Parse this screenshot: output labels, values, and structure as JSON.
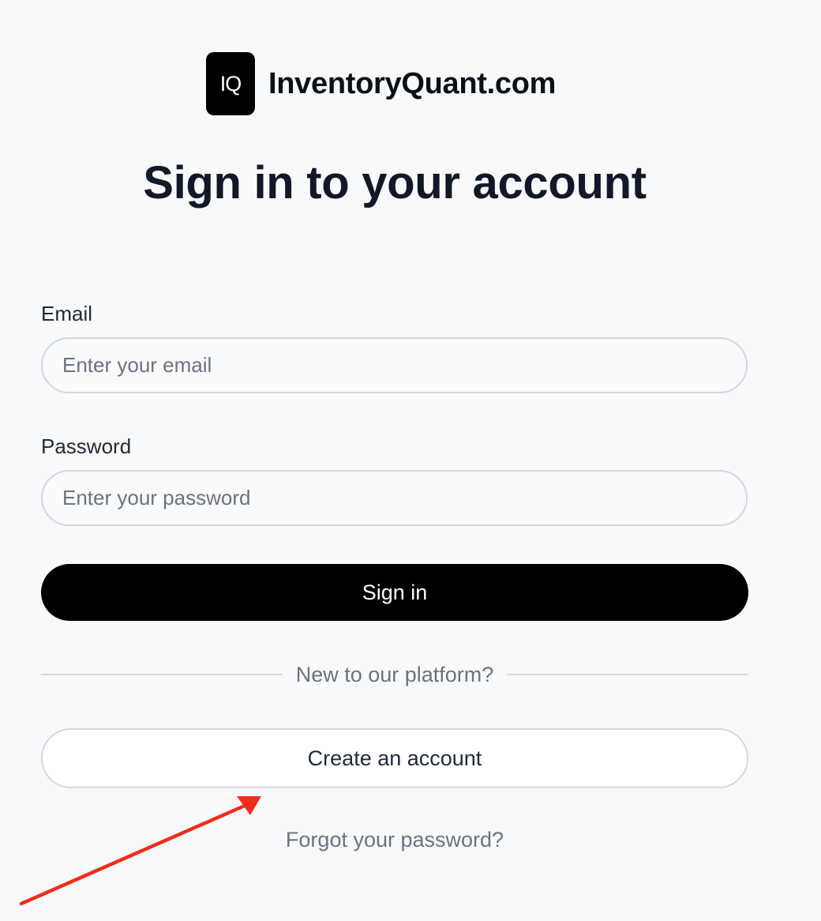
{
  "brand": {
    "logo_text": "IQ",
    "name": "InventoryQuant.com"
  },
  "title": "Sign in to your account",
  "form": {
    "email_label": "Email",
    "email_placeholder": "Enter your email",
    "password_label": "Password",
    "password_placeholder": "Enter your password",
    "signin_label": "Sign in"
  },
  "divider_text": "New to our platform?",
  "create_account_label": "Create an account",
  "forgot_password_label": "Forgot your password?",
  "annotation": {
    "arrow_color": "#f02d1a",
    "icon": "red-arrow-icon"
  },
  "colors": {
    "background": "#f8f9fb",
    "primary_button": "#000000",
    "muted_text": "#6b7280"
  }
}
